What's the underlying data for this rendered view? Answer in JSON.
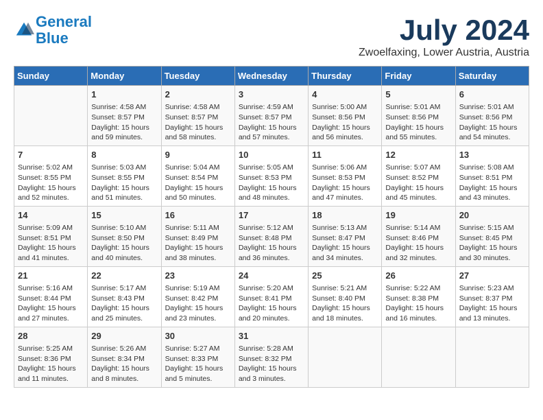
{
  "header": {
    "logo_line1": "General",
    "logo_line2": "Blue",
    "title": "July 2024",
    "subtitle": "Zwoelfaxing, Lower Austria, Austria"
  },
  "days_of_week": [
    "Sunday",
    "Monday",
    "Tuesday",
    "Wednesday",
    "Thursday",
    "Friday",
    "Saturday"
  ],
  "weeks": [
    [
      {
        "day": "",
        "info": ""
      },
      {
        "day": "1",
        "info": "Sunrise: 4:58 AM\nSunset: 8:57 PM\nDaylight: 15 hours\nand 59 minutes."
      },
      {
        "day": "2",
        "info": "Sunrise: 4:58 AM\nSunset: 8:57 PM\nDaylight: 15 hours\nand 58 minutes."
      },
      {
        "day": "3",
        "info": "Sunrise: 4:59 AM\nSunset: 8:57 PM\nDaylight: 15 hours\nand 57 minutes."
      },
      {
        "day": "4",
        "info": "Sunrise: 5:00 AM\nSunset: 8:56 PM\nDaylight: 15 hours\nand 56 minutes."
      },
      {
        "day": "5",
        "info": "Sunrise: 5:01 AM\nSunset: 8:56 PM\nDaylight: 15 hours\nand 55 minutes."
      },
      {
        "day": "6",
        "info": "Sunrise: 5:01 AM\nSunset: 8:56 PM\nDaylight: 15 hours\nand 54 minutes."
      }
    ],
    [
      {
        "day": "7",
        "info": "Sunrise: 5:02 AM\nSunset: 8:55 PM\nDaylight: 15 hours\nand 52 minutes."
      },
      {
        "day": "8",
        "info": "Sunrise: 5:03 AM\nSunset: 8:55 PM\nDaylight: 15 hours\nand 51 minutes."
      },
      {
        "day": "9",
        "info": "Sunrise: 5:04 AM\nSunset: 8:54 PM\nDaylight: 15 hours\nand 50 minutes."
      },
      {
        "day": "10",
        "info": "Sunrise: 5:05 AM\nSunset: 8:53 PM\nDaylight: 15 hours\nand 48 minutes."
      },
      {
        "day": "11",
        "info": "Sunrise: 5:06 AM\nSunset: 8:53 PM\nDaylight: 15 hours\nand 47 minutes."
      },
      {
        "day": "12",
        "info": "Sunrise: 5:07 AM\nSunset: 8:52 PM\nDaylight: 15 hours\nand 45 minutes."
      },
      {
        "day": "13",
        "info": "Sunrise: 5:08 AM\nSunset: 8:51 PM\nDaylight: 15 hours\nand 43 minutes."
      }
    ],
    [
      {
        "day": "14",
        "info": "Sunrise: 5:09 AM\nSunset: 8:51 PM\nDaylight: 15 hours\nand 41 minutes."
      },
      {
        "day": "15",
        "info": "Sunrise: 5:10 AM\nSunset: 8:50 PM\nDaylight: 15 hours\nand 40 minutes."
      },
      {
        "day": "16",
        "info": "Sunrise: 5:11 AM\nSunset: 8:49 PM\nDaylight: 15 hours\nand 38 minutes."
      },
      {
        "day": "17",
        "info": "Sunrise: 5:12 AM\nSunset: 8:48 PM\nDaylight: 15 hours\nand 36 minutes."
      },
      {
        "day": "18",
        "info": "Sunrise: 5:13 AM\nSunset: 8:47 PM\nDaylight: 15 hours\nand 34 minutes."
      },
      {
        "day": "19",
        "info": "Sunrise: 5:14 AM\nSunset: 8:46 PM\nDaylight: 15 hours\nand 32 minutes."
      },
      {
        "day": "20",
        "info": "Sunrise: 5:15 AM\nSunset: 8:45 PM\nDaylight: 15 hours\nand 30 minutes."
      }
    ],
    [
      {
        "day": "21",
        "info": "Sunrise: 5:16 AM\nSunset: 8:44 PM\nDaylight: 15 hours\nand 27 minutes."
      },
      {
        "day": "22",
        "info": "Sunrise: 5:17 AM\nSunset: 8:43 PM\nDaylight: 15 hours\nand 25 minutes."
      },
      {
        "day": "23",
        "info": "Sunrise: 5:19 AM\nSunset: 8:42 PM\nDaylight: 15 hours\nand 23 minutes."
      },
      {
        "day": "24",
        "info": "Sunrise: 5:20 AM\nSunset: 8:41 PM\nDaylight: 15 hours\nand 20 minutes."
      },
      {
        "day": "25",
        "info": "Sunrise: 5:21 AM\nSunset: 8:40 PM\nDaylight: 15 hours\nand 18 minutes."
      },
      {
        "day": "26",
        "info": "Sunrise: 5:22 AM\nSunset: 8:38 PM\nDaylight: 15 hours\nand 16 minutes."
      },
      {
        "day": "27",
        "info": "Sunrise: 5:23 AM\nSunset: 8:37 PM\nDaylight: 15 hours\nand 13 minutes."
      }
    ],
    [
      {
        "day": "28",
        "info": "Sunrise: 5:25 AM\nSunset: 8:36 PM\nDaylight: 15 hours\nand 11 minutes."
      },
      {
        "day": "29",
        "info": "Sunrise: 5:26 AM\nSunset: 8:34 PM\nDaylight: 15 hours\nand 8 minutes."
      },
      {
        "day": "30",
        "info": "Sunrise: 5:27 AM\nSunset: 8:33 PM\nDaylight: 15 hours\nand 5 minutes."
      },
      {
        "day": "31",
        "info": "Sunrise: 5:28 AM\nSunset: 8:32 PM\nDaylight: 15 hours\nand 3 minutes."
      },
      {
        "day": "",
        "info": ""
      },
      {
        "day": "",
        "info": ""
      },
      {
        "day": "",
        "info": ""
      }
    ]
  ]
}
